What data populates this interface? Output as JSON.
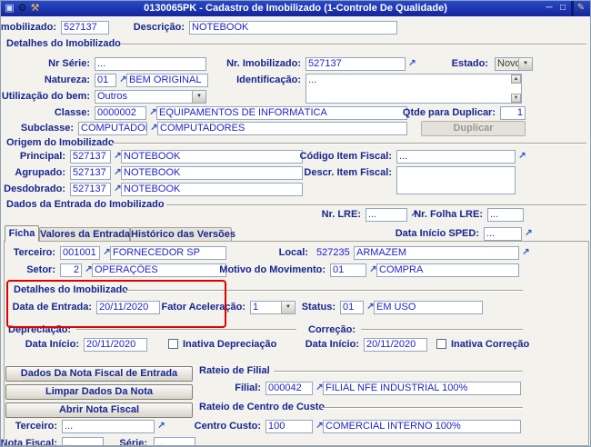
{
  "icons": {
    "app": "▣",
    "gear": "⚙",
    "wrench": "⚒",
    "pencil": "✎",
    "minimize": "─",
    "maximize": "□",
    "combo_arrow": "▼",
    "scroll_up": "▲",
    "scroll_down": "▼",
    "lookup": "↗"
  },
  "titlebar": {
    "title": "0130065PK - Cadastro de Imobilizado (1-Controle De Qualidade)"
  },
  "header": {
    "imobilizado": {
      "label": "Imobilizado:",
      "value": "527137"
    },
    "descricao": {
      "label": "Descrição:",
      "value": "NOTEBOOK"
    }
  },
  "detalhes": {
    "title": "Detalhes do Imobilizado",
    "nr_serie": {
      "label": "Nr Série:",
      "value": "..."
    },
    "nr_imobilizado": {
      "label": "Nr. Imobilizado:",
      "value": "527137"
    },
    "estado": {
      "label": "Estado:",
      "value": "Novo"
    },
    "natureza": {
      "label": "Natureza:",
      "code": "01",
      "desc": "BEM ORIGINAL"
    },
    "identificacao": {
      "label": "Identificação:",
      "value": "..."
    },
    "utilizacao": {
      "label": "Utilização do bem:",
      "value": "Outros"
    },
    "classe": {
      "label": "Classe:",
      "code": "0000002",
      "desc": "EQUIPAMENTOS DE INFORMÁTICA"
    },
    "qtde_duplicar": {
      "label": "Qtde para Duplicar:",
      "value": "1"
    },
    "subclasse": {
      "label": "Subclasse:",
      "code": "COMPUTADORES",
      "desc": "COMPUTADORES"
    },
    "duplicar_button": "Duplicar"
  },
  "origem": {
    "title": "Origem do Imobilizado",
    "principal": {
      "label": "Principal:",
      "code": "527137",
      "desc": "NOTEBOOK"
    },
    "agrupado": {
      "label": "Agrupado:",
      "code": "527137",
      "desc": "NOTEBOOK"
    },
    "desdobrado": {
      "label": "Desdobrado:",
      "code": "527137",
      "desc": "NOTEBOOK"
    },
    "codigo_item_fiscal": {
      "label": "Código Item Fiscal:",
      "value": "..."
    },
    "descr_item_fiscal": {
      "label": "Descr. Item Fiscal:",
      "value": ""
    }
  },
  "entrada": {
    "title": "Dados da Entrada do Imobilizado",
    "nr_lre": {
      "label": "Nr. LRE:",
      "value": "..."
    },
    "nr_folha_lre": {
      "label": "Nr. Folha LRE:",
      "value": "..."
    },
    "data_inicio_sped": {
      "label": "Data Início SPED:",
      "value": "..."
    }
  },
  "tabs": [
    {
      "label": "Ficha"
    },
    {
      "label": "Valores da Entrada"
    },
    {
      "label": "Histórico das Versões"
    }
  ],
  "ficha": {
    "terceiro": {
      "label": "Terceiro:",
      "code": "001001",
      "desc": "FORNECEDOR SP"
    },
    "local": {
      "label": "Local:",
      "code": "527235",
      "desc": "ARMAZEM"
    },
    "setor": {
      "label": "Setor:",
      "code": "2",
      "desc": "OPERAÇÕES"
    },
    "motivo": {
      "label": "Motivo do Movimento:",
      "code": "01",
      "desc": "COMPRA"
    },
    "detalhes_title": "Detalhes do Imobilizado",
    "data_entrada": {
      "label": "Data de Entrada:",
      "value": "20/11/2020"
    },
    "fator_aceleracao": {
      "label": "Fator Aceleração:",
      "value": "1"
    },
    "status": {
      "label": "Status:",
      "code": "01",
      "desc": "EM USO"
    },
    "depreciacao": {
      "title": "Depreciação:",
      "data_inicio": {
        "label": "Data Início:",
        "value": "20/11/2020"
      },
      "inativa_label": "Inativa Depreciação"
    },
    "correcao": {
      "title": "Correção:",
      "data_inicio": {
        "label": "Data Início:",
        "value": "20/11/2020"
      },
      "inativa_label": "Inativa Correção"
    },
    "nota_buttons": {
      "dados": "Dados Da Nota Fiscal de Entrada",
      "limpar": "Limpar Dados Da Nota",
      "abrir": "Abrir Nota Fiscal"
    },
    "rateio_filial": {
      "title": "Rateio de Filial",
      "filial": {
        "label": "Filial:",
        "code": "000042",
        "desc": "FILIAL NFE INDUSTRIAL 100%"
      }
    },
    "rateio_cc": {
      "title": "Rateio de Centro de Custo",
      "centro_custo": {
        "label": "Centro Custo:",
        "code": "100",
        "desc": "COMERCIAL INTERNO 100%"
      }
    },
    "nf_terceiro": {
      "label": "Terceiro:",
      "value": "..."
    },
    "nota_fiscal": {
      "label": "Nota Fiscal:",
      "value": "..."
    },
    "serie": {
      "label": "Série:",
      "value": "..."
    }
  }
}
